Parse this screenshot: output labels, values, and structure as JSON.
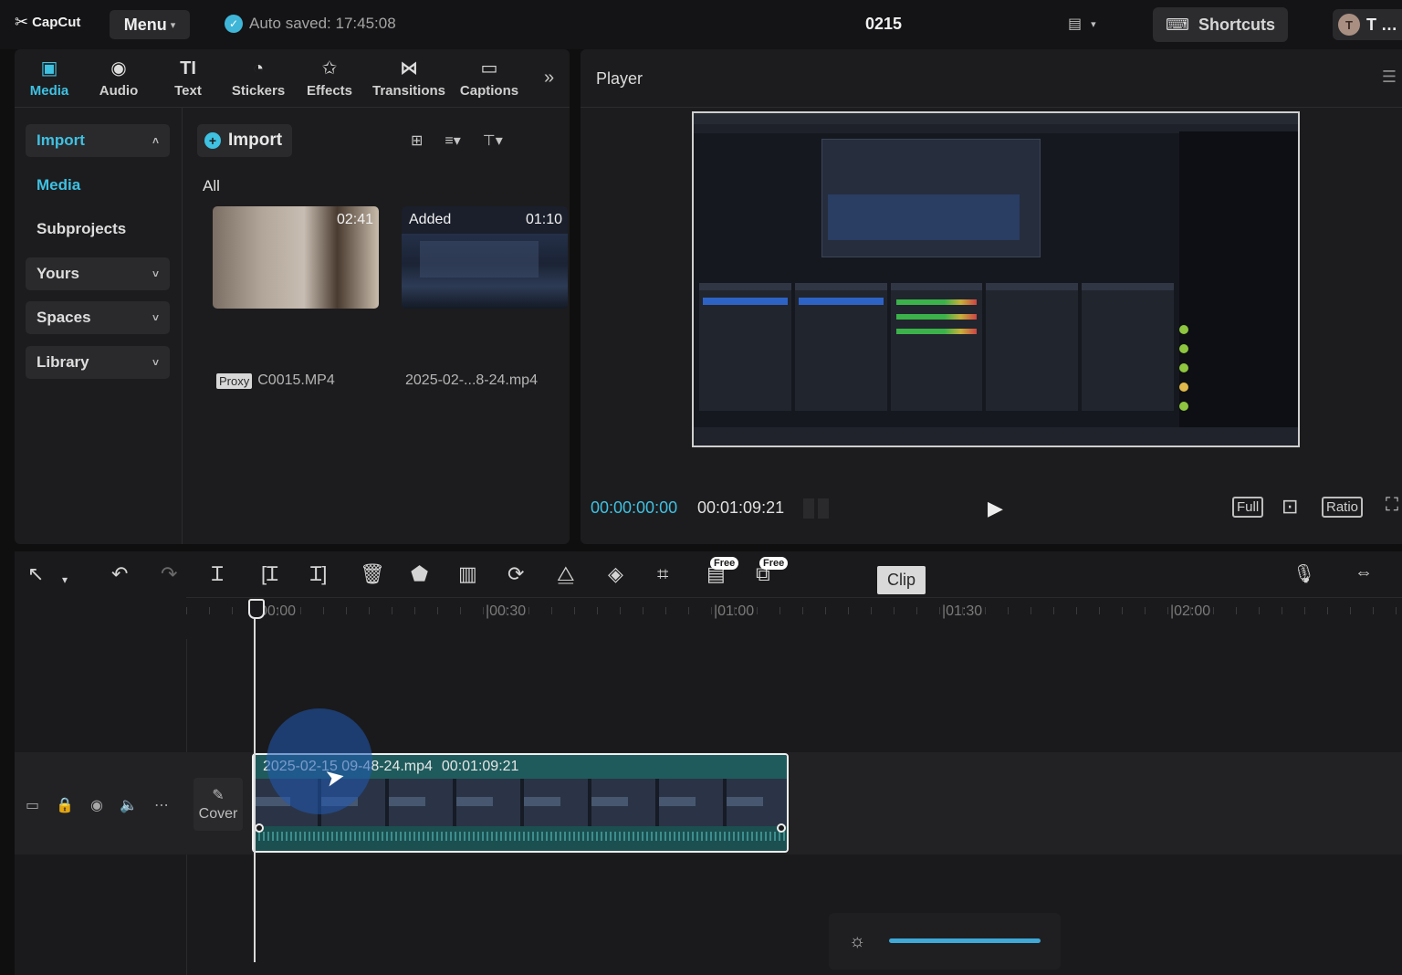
{
  "topbar": {
    "logo": "CapCut",
    "menu_label": "Menu",
    "autosave": "Auto saved: 17:45:08",
    "project_title": "0215",
    "shortcuts_label": "Shortcuts",
    "user_initial": "T",
    "user_label": "T ..."
  },
  "media_panel": {
    "tabs": [
      {
        "label": "Media",
        "icon": "media-icon"
      },
      {
        "label": "Audio",
        "icon": "audio-icon"
      },
      {
        "label": "Text",
        "icon": "text-icon"
      },
      {
        "label": "Stickers",
        "icon": "stickers-icon"
      },
      {
        "label": "Effects",
        "icon": "effects-icon"
      },
      {
        "label": "Transitions",
        "icon": "transitions-icon"
      },
      {
        "label": "Captions",
        "icon": "captions-icon"
      }
    ],
    "nav": {
      "import": "Import",
      "media": "Media",
      "subprojects": "Subprojects",
      "yours": "Yours",
      "spaces": "Spaces",
      "library": "Library"
    },
    "import_button": "Import",
    "filter_label": "All",
    "items": [
      {
        "duration": "02:41",
        "badge": "Proxy",
        "name": "C0015.MP4",
        "added": ""
      },
      {
        "duration": "01:10",
        "badge": "",
        "name": "2025-02-...8-24.mp4",
        "added": "Added"
      }
    ]
  },
  "player": {
    "title": "Player",
    "current_time": "00:00:00:00",
    "total_time": "00:01:09:21",
    "full_label": "Full",
    "ratio_label": "Ratio"
  },
  "timeline": {
    "tooltip": "Clip",
    "free_badge": "Free",
    "ruler": [
      "00:00",
      "|00:30",
      "|01:00",
      "|01:30",
      "|02:00"
    ],
    "clip": {
      "name": "2025-02-15 09-48-24.mp4",
      "duration": "00:01:09:21"
    },
    "cover_label": "Cover"
  },
  "colors": {
    "accent": "#3fc1e2",
    "background": "#1c1c1e",
    "clip_header": "#1f5b5c"
  }
}
